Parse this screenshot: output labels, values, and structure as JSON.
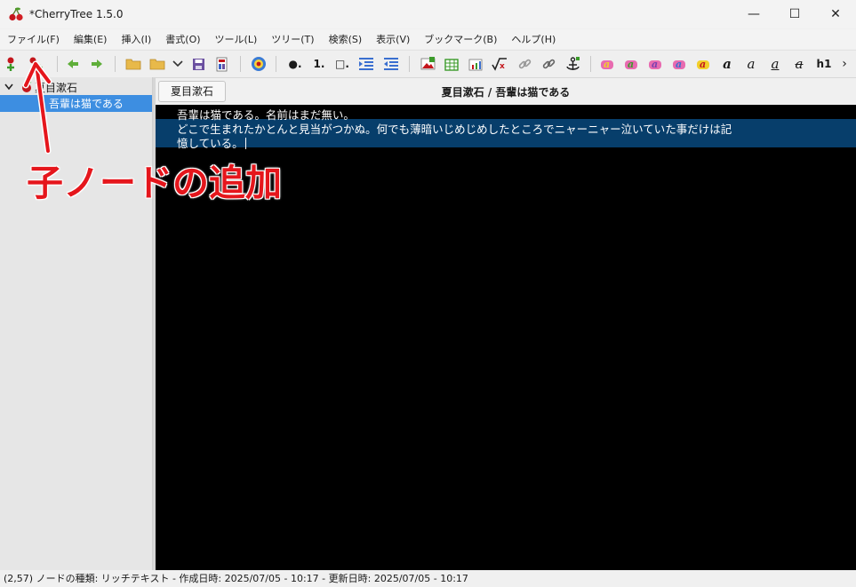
{
  "window": {
    "title": "*CherryTree 1.5.0",
    "controls": {
      "minimize": "—",
      "maximize": "☐",
      "close": "✕"
    }
  },
  "menubar": {
    "items": [
      "ファイル(F)",
      "編集(E)",
      "挿入(I)",
      "書式(O)",
      "ツール(L)",
      "ツリー(T)",
      "検索(S)",
      "表示(V)",
      "ブックマーク(B)",
      "ヘルプ(H)"
    ]
  },
  "toolbar": {
    "icons": [
      "add-node-icon",
      "add-child-node-icon",
      "go-back-icon",
      "go-forward-icon",
      "open-folder-icon",
      "open-recent-icon",
      "save-icon",
      "export-icon",
      "spellcheck-icon",
      "bulleted-list-icon",
      "numbered-list-icon",
      "todo-list-icon",
      "indent-icon",
      "unindent-icon",
      "insert-image-icon",
      "insert-table-icon",
      "insert-codebox-icon",
      "insert-latex-icon",
      "insert-link-icon",
      "insert-link-alt-icon",
      "insert-anchor-icon",
      "text-color-fg-icon",
      "text-color-bg-icon",
      "text-color-alt-icon",
      "text-color-alt2-icon",
      "highlight-icon",
      "bold-icon",
      "italic-icon",
      "underline-icon",
      "strikethrough-icon",
      "heading-icon"
    ],
    "list_labels": {
      "bullet": "●.",
      "number": "1.",
      "todo": "□."
    },
    "heading_label": "h1",
    "text_glyphs": {
      "bold": "a",
      "italic": "a",
      "underline": "a",
      "strike": "a"
    }
  },
  "tree": {
    "root": {
      "label": "夏目漱石",
      "expanded": true
    },
    "children": [
      {
        "label": "吾輩は猫である",
        "selected": true
      }
    ]
  },
  "breadcrumb": {
    "parent_button": "夏目漱石"
  },
  "node_title": "夏目漱石 / 吾輩は猫である",
  "editor": {
    "lines": [
      "吾輩は猫である。名前はまだ無い。",
      "どこで生まれたかとんと見当がつかぬ。何でも薄暗いじめじめしたところでニャーニャー泣いていた事だけは記",
      "憶している。"
    ]
  },
  "statusbar": {
    "text": "(2,57)   ノードの種類: リッチテキスト  -  作成日時: 2025/07/05 - 10:17  -  更新日時: 2025/07/05 - 10:17"
  },
  "annotation": {
    "label": "子ノードの追加",
    "color": "#e5161c"
  },
  "colors": {
    "selection": "#3d8ee1",
    "editor_bg": "#000000",
    "editor_selection": "#073e6b"
  }
}
